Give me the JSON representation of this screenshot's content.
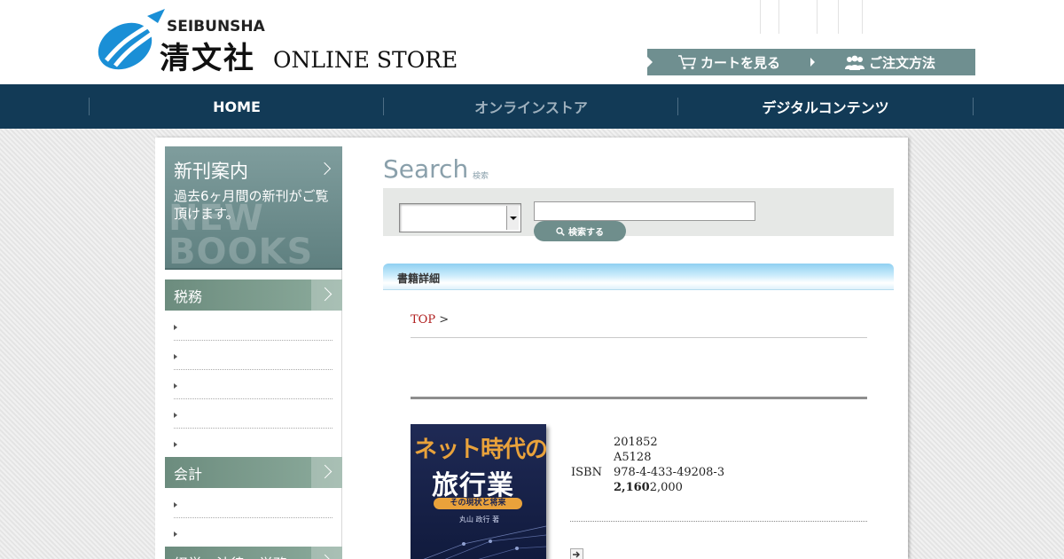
{
  "header": {
    "logo_en": "SEIBUNSHA",
    "logo_jp": "清文社",
    "logo_store": "ONLINE STORE",
    "cart_label": "カートを見る",
    "order_label": "ご注文方法"
  },
  "nav": {
    "items": [
      {
        "label": "HOME",
        "active": false
      },
      {
        "label": "オンラインストア",
        "active": true
      },
      {
        "label": "デジタルコンテンツ",
        "active": false
      }
    ]
  },
  "sidebar": {
    "newbooks": {
      "title": "新刊案内",
      "desc": "過去6ヶ月間の新刊がご覧頂けます。",
      "bg_text_1": "NEW",
      "bg_text_2": "BOOKS"
    },
    "categories": [
      {
        "label": "税務"
      },
      {
        "label": "会計"
      },
      {
        "label": "経営・法律・労務"
      }
    ]
  },
  "search": {
    "title": "Search",
    "subtitle": "検索",
    "select_value": "",
    "keyword_value": "",
    "keyword_placeholder": "",
    "button_label": "検索する"
  },
  "detail": {
    "section_label": "書籍詳細",
    "breadcrumb_top": "TOP",
    "breadcrumb_sep": ">",
    "cover": {
      "title_line1": "ネット時代の",
      "title_line2": "旅行業",
      "subtitle": "その現状と将来",
      "author": "丸山 政行 著"
    },
    "info": {
      "date": "201852",
      "format": "A5128",
      "isbn_label": "ISBN",
      "isbn": "978-4-433-49208-3",
      "price_tax": "2,160",
      "price": "2,000"
    }
  },
  "colors": {
    "nav_bg": "#123a56",
    "header_btn_bg": "#6f8f90",
    "category_bg": "#7a9a8b",
    "breadcrumb_link": "#b01e1e",
    "search_title": "#8aa0ab"
  },
  "icons": {
    "cart": "cart-icon",
    "order": "people-icon",
    "search": "magnifier-icon",
    "detail_arrow": "arrow-right-icon"
  }
}
